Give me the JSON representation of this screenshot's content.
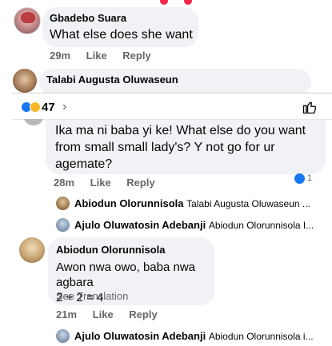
{
  "top_comment": {
    "author": "Gbadebo Suara",
    "text": "What else does she want",
    "time": "29m",
    "like_label": "Like",
    "reply_label": "Reply"
  },
  "next_comment_author": "Talabi Augusta Oluwaseun",
  "panel": {
    "reaction_count": "47",
    "chevron": "›",
    "colors": {
      "accent": "#1877f2",
      "bubble": "#f0f2f5",
      "meta": "#65676b"
    }
  },
  "comment_body": {
    "text": "Ika ma ni baba yi ke! What else do you want from small small lady's? Y not go for ur agemate?",
    "time": "28m",
    "like_label": "Like",
    "reply_label": "Reply",
    "reaction_count": "1"
  },
  "replies_a": [
    {
      "name": "Abiodun Olorunnisola",
      "preview": "Talabi Augusta Oluwaseun ..."
    },
    {
      "name": "Ajulo Oluwatosin Adebanji",
      "preview": "Abiodun Olorunnisola I..."
    }
  ],
  "comment_abiodun": {
    "author": "Abiodun Olorunnisola",
    "line1": "Awon nwa owo, baba nwa agbara",
    "line2": "2 + 2 = 4",
    "see_translation": "See Translation",
    "time": "21m",
    "like_label": "Like",
    "reply_label": "Reply"
  },
  "replies_b": [
    {
      "name": "Ajulo Oluwatosin Adebanji",
      "preview": "Abiodun Olorunnisola i..."
    }
  ]
}
